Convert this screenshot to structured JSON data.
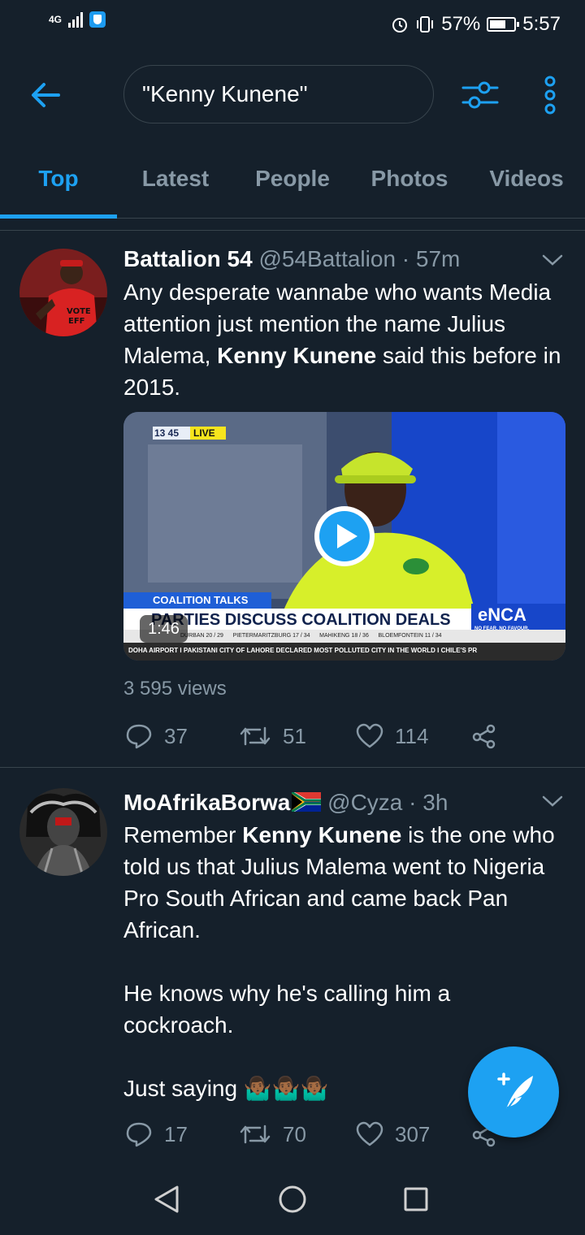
{
  "status_bar": {
    "network": "4G",
    "battery": "57%",
    "time": "5:57"
  },
  "search": {
    "query": "\"Kenny Kunene\""
  },
  "tabs": [
    {
      "label": "Top",
      "active": true
    },
    {
      "label": "Latest",
      "active": false
    },
    {
      "label": "People",
      "active": false
    },
    {
      "label": "Photos",
      "active": false
    },
    {
      "label": "Videos",
      "active": false
    }
  ],
  "tweets": [
    {
      "name": "Battalion 54",
      "meta": " @54Battalion · 57m",
      "text_before": "Any desperate wannabe who wants Media attention just mention the name Julius Malema, ",
      "text_bold": "Kenny Kunene",
      "text_after": " said this before in 2015.",
      "video": {
        "clock": "13 45",
        "live": "LIVE",
        "section": "COALITION TALKS",
        "headline": "PARTIES DISCUSS COALITION DEALS",
        "brand_e": "e",
        "brand": "NCA",
        "slogan": "NO FEAR. NO FAVOUR.",
        "weather": "DURBAN 20 / 29      PIETERMARITZBURG 17 / 34      MAHIKENG 18 / 36      BLOEMFONTEIN 11 / 34",
        "ticker": "DOHA AIRPORT  I  PAKISTANI CITY OF LAHORE DECLARED MOST POLLUTED CITY IN THE WORLD  I  CHILE'S PR",
        "duration": "1:46"
      },
      "views": "3 595 views",
      "replies": "37",
      "retweets": "51",
      "likes": "114"
    },
    {
      "name": "MoAfrikaBorwa",
      "meta": " @Cyza · 3h",
      "text_before": "Remember ",
      "text_bold": "Kenny Kunene",
      "text_after": " is the one who told us that Julius Malema went to Nigeria Pro South African and came back Pan African.\n\nHe knows why he's calling him a cockroach.\n\nJust saying 🤷🏾‍♂️🤷🏾‍♂️🤷🏾‍♂️",
      "replies": "17",
      "retweets": "70",
      "likes": "307"
    }
  ],
  "colors": {
    "background": "#15202b",
    "accent": "#1da1f2",
    "secondary_text": "#8899a6",
    "divider": "#38444d"
  }
}
